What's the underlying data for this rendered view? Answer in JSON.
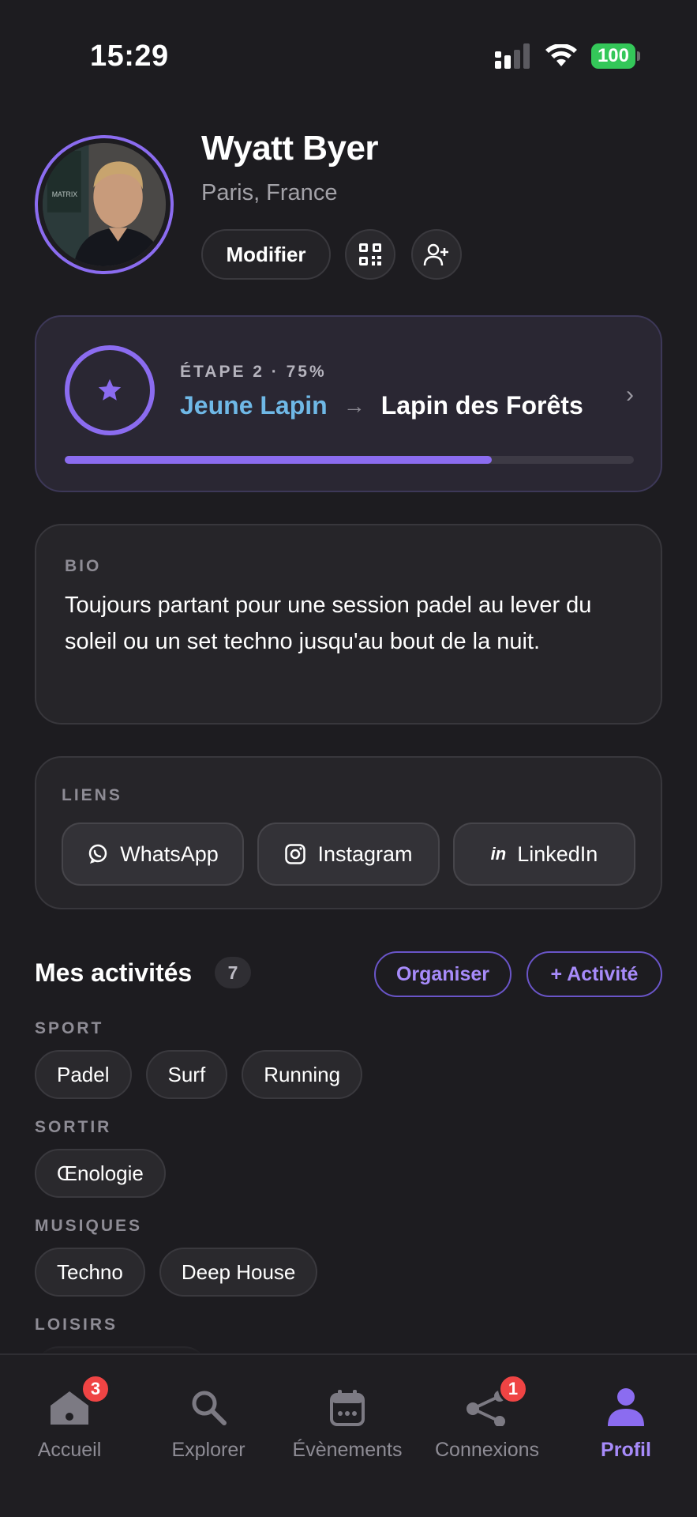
{
  "status_bar": {
    "time": "15:29",
    "battery": "100"
  },
  "profile": {
    "name": "Wyatt Byer",
    "location": "Paris, France",
    "edit_label": "Modifier",
    "avatar_poster_text": "MATRIX"
  },
  "progress": {
    "stage_label": "ÉTAPE 2 · 75%",
    "from": "Jeune Lapin",
    "arrow": "→",
    "to": "Lapin des Forêts",
    "percent": 75
  },
  "bio": {
    "label": "BIO",
    "text": "Toujours partant pour une session padel au lever du soleil ou un set techno jusqu'au bout de la nuit."
  },
  "links": {
    "label": "LIENS",
    "items": [
      {
        "label": "WhatsApp",
        "icon": "whatsapp-icon"
      },
      {
        "label": "Instagram",
        "icon": "instagram-icon"
      },
      {
        "label": "LinkedIn",
        "icon": "linkedin-icon",
        "glyph": "in"
      }
    ]
  },
  "activities": {
    "title": "Mes activités",
    "count": "7",
    "organize_label": "Organiser",
    "add_label": "+ Activité",
    "categories": [
      {
        "label": "SPORT",
        "items": [
          "Padel",
          "Surf",
          "Running"
        ]
      },
      {
        "label": "SORTIR",
        "items": [
          "Œnologie"
        ]
      },
      {
        "label": "MUSIQUES",
        "items": [
          "Techno",
          "Deep House"
        ]
      },
      {
        "label": "LOISIRS",
        "items": []
      }
    ]
  },
  "tabbar": {
    "items": [
      {
        "label": "Accueil",
        "icon": "home-icon",
        "badge": "3"
      },
      {
        "label": "Explorer",
        "icon": "search-icon"
      },
      {
        "label": "Évènements",
        "icon": "calendar-icon"
      },
      {
        "label": "Connexions",
        "icon": "share-icon",
        "badge": "1"
      },
      {
        "label": "Profil",
        "icon": "profile-icon",
        "active": true
      }
    ]
  },
  "colors": {
    "accent": "#8b6cf0",
    "accent_text": "#a78bfa",
    "link_blue": "#6fb8e6",
    "badge": "#ef4444",
    "battery": "#34c759"
  }
}
